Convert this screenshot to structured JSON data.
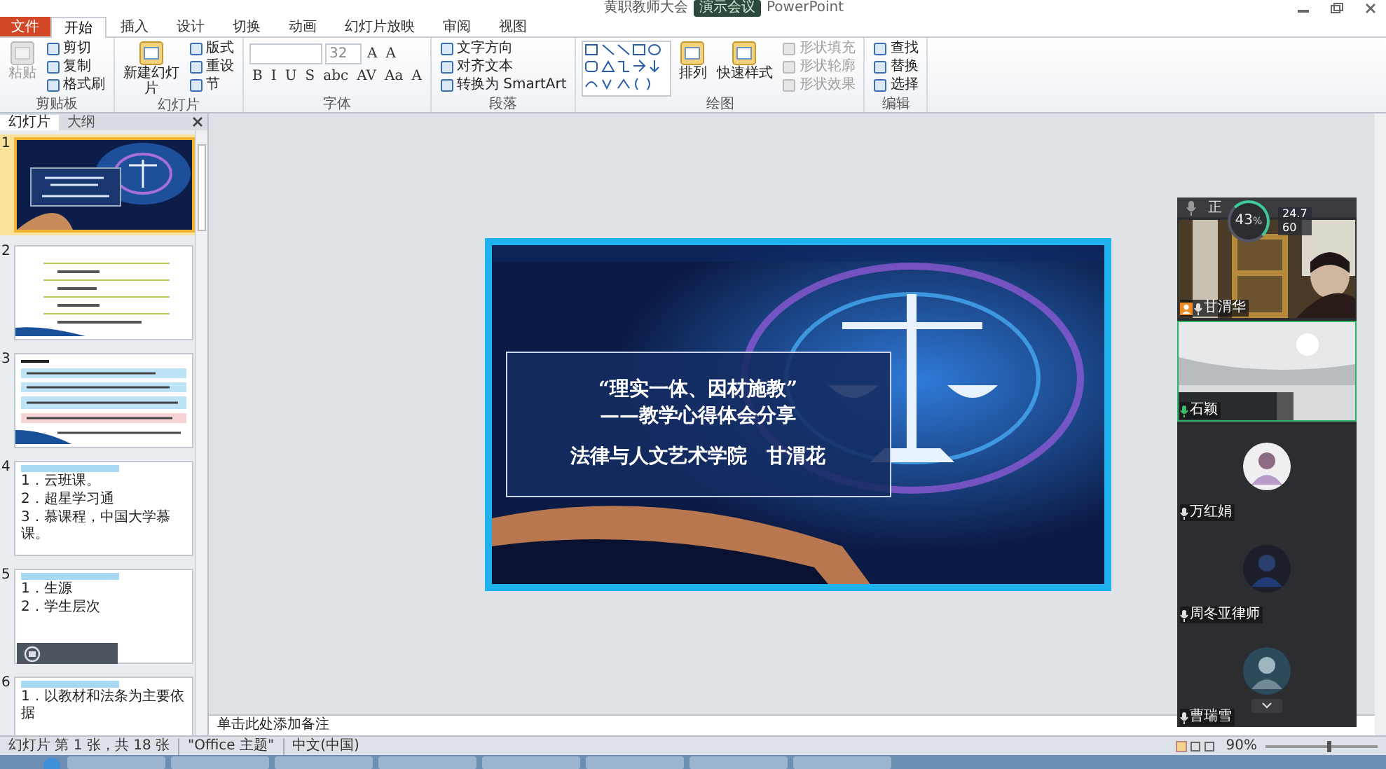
{
  "title_bar": {
    "title": "黄职教师大会",
    "badge": "演示会议",
    "app": "PowerPoint"
  },
  "tabs": [
    {
      "label": "文件",
      "kind": "file",
      "selected": false
    },
    {
      "label": "开始",
      "kind": "tab",
      "selected": true
    },
    {
      "label": "插入",
      "kind": "tab",
      "selected": false
    },
    {
      "label": "设计",
      "kind": "tab",
      "selected": false
    },
    {
      "label": "切换",
      "kind": "tab",
      "selected": false
    },
    {
      "label": "动画",
      "kind": "tab",
      "selected": false
    },
    {
      "label": "幻灯片放映",
      "kind": "tab",
      "selected": false
    },
    {
      "label": "审阅",
      "kind": "tab",
      "selected": false
    },
    {
      "label": "视图",
      "kind": "tab",
      "selected": false
    }
  ],
  "ribbon": [
    {
      "label": "剪贴板",
      "kind": "stack",
      "large": [
        {
          "label": "粘贴",
          "disabled": true
        }
      ],
      "small": [
        {
          "label": "剪切",
          "disabled": false
        },
        {
          "label": "复制",
          "disabled": false
        },
        {
          "label": "格式刷",
          "disabled": false
        }
      ]
    },
    {
      "label": "幻灯片",
      "kind": "stack",
      "large": [
        {
          "label": "新建幻灯片",
          "disabled": false
        }
      ],
      "small": [
        {
          "label": "版式",
          "disabled": false
        },
        {
          "label": "重设",
          "disabled": false
        },
        {
          "label": "节",
          "disabled": false
        }
      ]
    },
    {
      "label": "字体",
      "kind": "font",
      "size": "32",
      "buttons": [
        "A",
        "A",
        "B",
        "I",
        "U",
        "S",
        "abc",
        "AV",
        "Aa",
        "A"
      ]
    },
    {
      "label": "段落",
      "kind": "stack",
      "small": [
        {
          "label": "文字方向",
          "disabled": false
        },
        {
          "label": "对齐文本",
          "disabled": false
        },
        {
          "label": "转换为 SmartArt",
          "disabled": false
        }
      ]
    },
    {
      "label": "绘图",
      "kind": "drawing",
      "large": [
        {
          "label": "排列",
          "disabled": false
        },
        {
          "label": "快速样式",
          "disabled": false
        }
      ],
      "small": [
        {
          "label": "形状填充",
          "disabled": true
        },
        {
          "label": "形状轮廓",
          "disabled": true
        },
        {
          "label": "形状效果",
          "disabled": true
        }
      ]
    },
    {
      "label": "编辑",
      "kind": "stack",
      "small": [
        {
          "label": "查找",
          "disabled": false
        },
        {
          "label": "替换",
          "disabled": false
        },
        {
          "label": "选择",
          "disabled": false
        }
      ]
    }
  ],
  "panel_tabs": [
    {
      "label": "幻灯片",
      "selected": true
    },
    {
      "label": "大纲",
      "selected": false
    }
  ],
  "slides": [
    {
      "number": "1",
      "kind": "title",
      "selected": true
    },
    {
      "number": "2",
      "kind": "lines",
      "selected": false
    },
    {
      "number": "3",
      "kind": "lines",
      "selected": false
    },
    {
      "number": "4",
      "kind": "text",
      "selected": false,
      "lines": [
        "1．云班课。",
        "2．超星学习通",
        "3．慕课程，中国大学慕课。"
      ]
    },
    {
      "number": "5",
      "kind": "text",
      "selected": false,
      "lines": [
        "1．生源",
        "2．学生层次"
      ]
    },
    {
      "number": "6",
      "kind": "text",
      "selected": false,
      "lines": [
        "1．以教材和法条为主要依据"
      ]
    }
  ],
  "slide": {
    "title": "“理实一体、因材施教”",
    "subtitle": "——教学心得体会分享",
    "author": "法律与人文艺术学院　甘渭花"
  },
  "notes": {
    "placeholder": "单击此处添加备注"
  },
  "meeting": {
    "status": "正",
    "network": {
      "percent": "43",
      "unit": "%",
      "up": "24.7",
      "down": "60"
    },
    "participants": [
      {
        "name": "甘渭华",
        "kind": "video",
        "host": true,
        "speaking": false
      },
      {
        "name": "石颖",
        "kind": "video",
        "host": false,
        "speaking": true
      },
      {
        "name": "万红娟",
        "kind": "avatar",
        "host": false,
        "speaking": false
      },
      {
        "name": "周冬亚律师",
        "kind": "avatar",
        "host": false,
        "speaking": false
      },
      {
        "name": "曹瑞雪",
        "kind": "avatar",
        "host": false,
        "speaking": false
      }
    ]
  },
  "status_bar": {
    "slide": "幻灯片 第 1 张，共 18 张",
    "theme": "\"Office 主题\"",
    "language": "中文(中国)",
    "zoom": "90%",
    "zoom_slider": {
      "level": 0.55
    }
  }
}
